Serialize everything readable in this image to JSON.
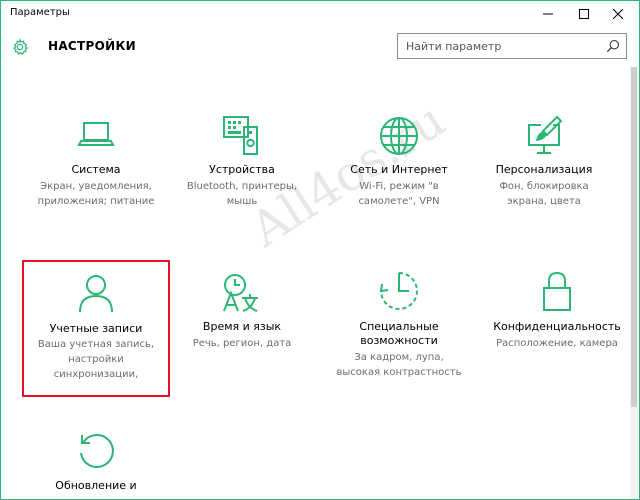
{
  "window": {
    "title": "Параметры",
    "controls": {
      "minimize": "—",
      "maximize": "☐",
      "close": "✕"
    }
  },
  "header": {
    "title": "НАСТРОЙКИ",
    "icon": "gear-icon"
  },
  "search": {
    "placeholder": "Найти параметр",
    "icon": "search-icon"
  },
  "accent_color": "#2bb673",
  "selection_color": "#e81123",
  "tiles": [
    {
      "id": "system",
      "icon": "laptop-icon",
      "title": "Система",
      "description": "Экран, уведомления,\nприложения; питание"
    },
    {
      "id": "devices",
      "icon": "devices-icon",
      "title": "Устройства",
      "description": "Bluetooth, принтеры,\nмышь"
    },
    {
      "id": "network",
      "icon": "globe-icon",
      "title": "Сеть и Интернет",
      "description": "Wi-Fi, режим \"в\nсамолете\", VPN"
    },
    {
      "id": "personalization",
      "icon": "paint-icon",
      "title": "Персонализация",
      "description": "Фон, блокировка\nэкрана, цвета"
    },
    {
      "id": "accounts",
      "icon": "user-icon",
      "title": "Учетные записи",
      "description": "Ваша учетная запись,\nнастройки\nсинхронизации,",
      "selected": true
    },
    {
      "id": "time",
      "icon": "time-language-icon",
      "title": "Время и язык",
      "description": "Речь, регион, дата"
    },
    {
      "id": "ease",
      "icon": "accessibility-icon",
      "title": "Специальные\nвозможности",
      "description": "За кадром, лупа,\nвысокая контрастность"
    },
    {
      "id": "privacy",
      "icon": "lock-icon",
      "title": "Конфиденциальность",
      "description": "Расположение, камера"
    },
    {
      "id": "update",
      "icon": "update-icon",
      "title": "Обновление и",
      "description": ""
    }
  ],
  "watermark": "All4os.ru"
}
